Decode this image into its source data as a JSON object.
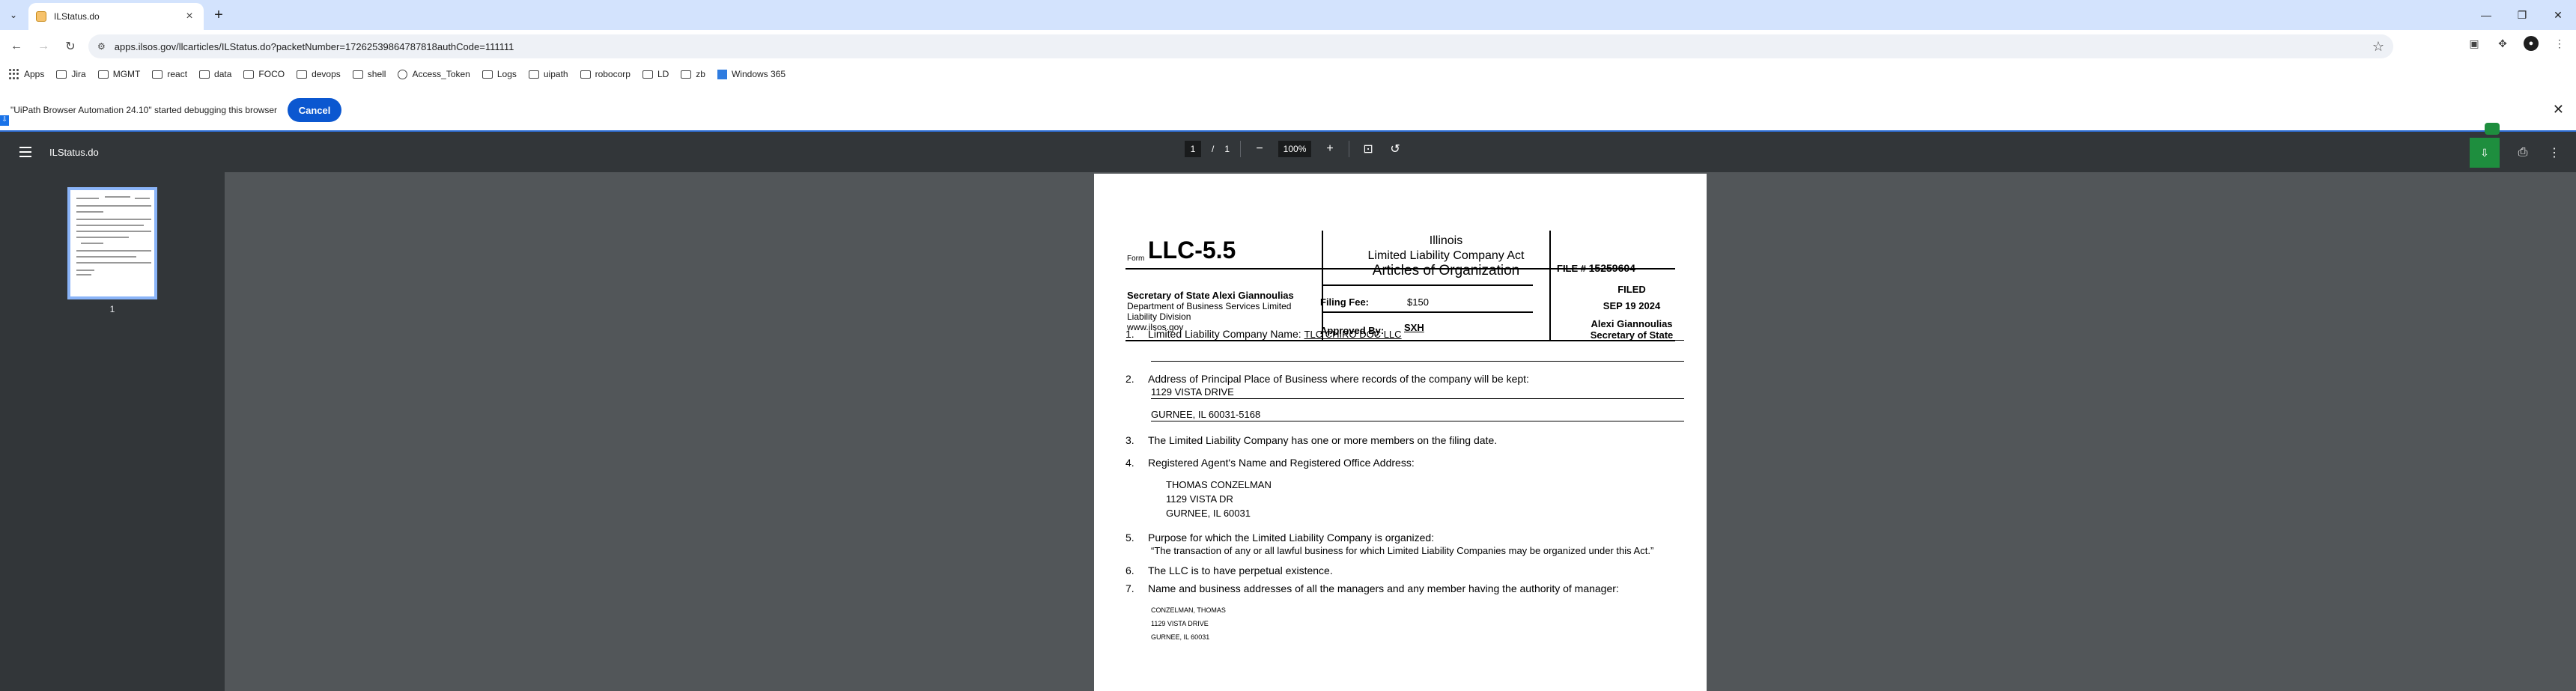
{
  "browser": {
    "tab_title": "ILStatus.do",
    "url": "apps.ilsos.gov/llcarticles/ILStatus.do?packetNumber=17262539864787818authCode=111111",
    "bookmarks": [
      "Apps",
      "Jira",
      "MGMT",
      "react",
      "data",
      "FOCO",
      "devops",
      "shell",
      "Access_Token",
      "Logs",
      "uipath",
      "robocorp",
      "LD",
      "zb",
      "Windows 365"
    ]
  },
  "debug_bar": {
    "message": "\"UiPath Browser Automation 24.10\" started debugging this browser",
    "cancel_label": "Cancel"
  },
  "pdf_viewer": {
    "title": "ILStatus.do",
    "page_current": "1",
    "page_sep": "/",
    "page_total": "1",
    "zoom": "100%",
    "thumb_label": "1"
  },
  "document": {
    "form_label": "Form",
    "form_number": "LLC-5.5",
    "title_lines": [
      "Illinois",
      "Limited Liability Company Act",
      "Articles of Organization"
    ],
    "file_label": "FILE #",
    "file_number": "15259604",
    "sos_name": "Secretary of State Alexi Giannoulias",
    "sos_lines": [
      "Department of Business Services Limited",
      "Liability Division",
      "www.ilsos.gov"
    ],
    "filing_fee_label": "Filing Fee:",
    "filing_fee_value": "$150",
    "approved_label": "Approved By:",
    "approved_value": "SXH",
    "filed_lines": [
      "FILED",
      "SEP 19 2024",
      "Alexi Giannoulias",
      "Secretary of State"
    ],
    "items": [
      {
        "num": "1.",
        "text": "Limited Liability Company Name:",
        "value": "TLC CHIRO DOC LLC"
      },
      {
        "num": "2.",
        "text": "Address of Principal Place of Business where records of the company will be kept:",
        "value1": "1129 VISTA DRIVE",
        "value2": "GURNEE, IL 60031-5168"
      },
      {
        "num": "3.",
        "text": "The Limited Liability Company has one or more members on the filing date."
      },
      {
        "num": "4.",
        "text": "Registered Agent's Name and Registered Office Address:",
        "lines": [
          "THOMAS CONZELMAN",
          "1129 VISTA DR",
          "GURNEE, IL 60031"
        ]
      },
      {
        "num": "5.",
        "text": "Purpose for which the Limited Liability Company is organized:",
        "value": "“The transaction of any or all lawful business for which Limited Liability Companies may be organized under this Act.”"
      },
      {
        "num": "6.",
        "text": "The LLC is to have perpetual existence."
      },
      {
        "num": "7.",
        "text": "Name and business addresses of all the managers and any member having the authority of manager:",
        "lines": [
          "CONZELMAN, THOMAS",
          "1129 VISTA DRIVE",
          "GURNEE, IL 60031"
        ]
      }
    ]
  }
}
